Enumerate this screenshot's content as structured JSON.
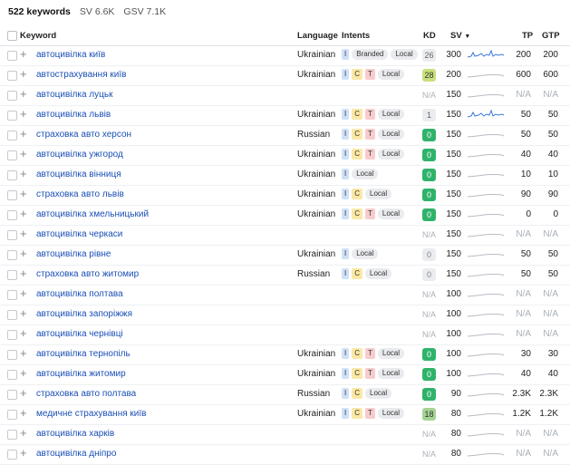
{
  "summary": {
    "keywords": "522 keywords",
    "sv": "SV 6.6K",
    "gsv": "GSV 7.1K"
  },
  "columns": {
    "keyword": "Keyword",
    "language": "Language",
    "intents": "Intents",
    "kd": "KD",
    "sv": "SV",
    "sort_icon": "caret-down-icon",
    "tp": "TP",
    "gtp": "GTP"
  },
  "rows": [
    {
      "keyword": "автоцивілка київ",
      "language": "Ukrainian",
      "intents": [
        "I"
      ],
      "tags": [
        "Branded",
        "Local"
      ],
      "kd": "26",
      "sv": "300",
      "tp": "200",
      "gtp": "200",
      "trend": "active"
    },
    {
      "keyword": "автострахування київ",
      "language": "Ukrainian",
      "intents": [
        "I",
        "C",
        "T"
      ],
      "tags": [
        "Local"
      ],
      "kd": "28",
      "sv": "200",
      "tp": "600",
      "gtp": "600",
      "trend": "flat"
    },
    {
      "keyword": "автоцивілка луцьк",
      "language": "",
      "intents": [],
      "tags": [],
      "kd": "N/A",
      "sv": "150",
      "tp": "N/A",
      "gtp": "N/A",
      "trend": "flat"
    },
    {
      "keyword": "автоцивілка львів",
      "language": "Ukrainian",
      "intents": [
        "I",
        "C",
        "T"
      ],
      "tags": [
        "Local"
      ],
      "kd": "1",
      "sv": "150",
      "tp": "50",
      "gtp": "50",
      "trend": "active"
    },
    {
      "keyword": "страховка авто херсон",
      "language": "Russian",
      "intents": [
        "I",
        "C",
        "T"
      ],
      "tags": [
        "Local"
      ],
      "kd": "0",
      "sv": "150",
      "tp": "50",
      "gtp": "50",
      "trend": "flat"
    },
    {
      "keyword": "автоцивілка ужгород",
      "language": "Ukrainian",
      "intents": [
        "I",
        "C",
        "T"
      ],
      "tags": [
        "Local"
      ],
      "kd": "0",
      "sv": "150",
      "tp": "40",
      "gtp": "40",
      "trend": "flat"
    },
    {
      "keyword": "автоцивілка вінниця",
      "language": "Ukrainian",
      "intents": [
        "I"
      ],
      "tags": [
        "Local"
      ],
      "kd": "0",
      "sv": "150",
      "tp": "10",
      "gtp": "10",
      "trend": "flat"
    },
    {
      "keyword": "страховка авто львів",
      "language": "Ukrainian",
      "intents": [
        "I",
        "C"
      ],
      "tags": [
        "Local"
      ],
      "kd": "0",
      "sv": "150",
      "tp": "90",
      "gtp": "90",
      "trend": "flat"
    },
    {
      "keyword": "автоцивілка хмельницький",
      "language": "Ukrainian",
      "intents": [
        "I",
        "C",
        "T"
      ],
      "tags": [
        "Local"
      ],
      "kd": "0",
      "sv": "150",
      "tp": "0",
      "gtp": "0",
      "trend": "flat"
    },
    {
      "keyword": "автоцивілка черкаси",
      "language": "",
      "intents": [],
      "tags": [],
      "kd": "N/A",
      "sv": "150",
      "tp": "N/A",
      "gtp": "N/A",
      "trend": "flat"
    },
    {
      "keyword": "автоцивілка рівне",
      "language": "Ukrainian",
      "intents": [
        "I"
      ],
      "tags": [
        "Local"
      ],
      "kd": "0",
      "sv": "150",
      "tp": "50",
      "gtp": "50",
      "trend": "flat",
      "kd_grey": true
    },
    {
      "keyword": "страховка авто житомир",
      "language": "Russian",
      "intents": [
        "I",
        "C"
      ],
      "tags": [
        "Local"
      ],
      "kd": "0",
      "sv": "150",
      "tp": "50",
      "gtp": "50",
      "trend": "flat",
      "kd_grey": true
    },
    {
      "keyword": "автоцивілка полтава",
      "language": "",
      "intents": [],
      "tags": [],
      "kd": "N/A",
      "sv": "100",
      "tp": "N/A",
      "gtp": "N/A",
      "trend": "flat"
    },
    {
      "keyword": "автоцивілка запоріжжя",
      "language": "",
      "intents": [],
      "tags": [],
      "kd": "N/A",
      "sv": "100",
      "tp": "N/A",
      "gtp": "N/A",
      "trend": "flat"
    },
    {
      "keyword": "автоцивілка чернівці",
      "language": "",
      "intents": [],
      "tags": [],
      "kd": "N/A",
      "sv": "100",
      "tp": "N/A",
      "gtp": "N/A",
      "trend": "flat"
    },
    {
      "keyword": "автоцивілка тернопіль",
      "language": "Ukrainian",
      "intents": [
        "I",
        "C",
        "T"
      ],
      "tags": [
        "Local"
      ],
      "kd": "0",
      "sv": "100",
      "tp": "30",
      "gtp": "30",
      "trend": "flat"
    },
    {
      "keyword": "автоцивілка житомир",
      "language": "Ukrainian",
      "intents": [
        "I",
        "C",
        "T"
      ],
      "tags": [
        "Local"
      ],
      "kd": "0",
      "sv": "100",
      "tp": "40",
      "gtp": "40",
      "trend": "flat"
    },
    {
      "keyword": "страховка авто полтава",
      "language": "Russian",
      "intents": [
        "I",
        "C"
      ],
      "tags": [
        "Local"
      ],
      "kd": "0",
      "sv": "90",
      "tp": "2.3K",
      "gtp": "2.3K",
      "trend": "flat"
    },
    {
      "keyword": "медичне страхування київ",
      "language": "Ukrainian",
      "intents": [
        "I",
        "C",
        "T"
      ],
      "tags": [
        "Local"
      ],
      "kd": "18",
      "sv": "80",
      "tp": "1.2K",
      "gtp": "1.2K",
      "trend": "flat"
    },
    {
      "keyword": "автоцивілка харків",
      "language": "",
      "intents": [],
      "tags": [],
      "kd": "N/A",
      "sv": "80",
      "tp": "N/A",
      "gtp": "N/A",
      "trend": "flat"
    },
    {
      "keyword": "автоцивілка дніпро",
      "language": "",
      "intents": [],
      "tags": [],
      "kd": "N/A",
      "sv": "80",
      "tp": "N/A",
      "gtp": "N/A",
      "trend": "flat"
    }
  ],
  "colors": {
    "link": "#1a4fb5",
    "kd_easy": "#2fb36a",
    "intent_i": "#cfe1f7",
    "intent_c": "#fbe8a6",
    "intent_t": "#f8cccc"
  }
}
